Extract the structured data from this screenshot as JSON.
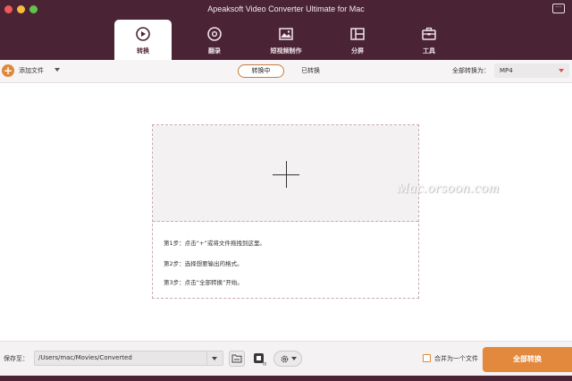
{
  "window": {
    "title": "Apeaksoft Video Converter Ultimate for Mac"
  },
  "tabs": [
    {
      "label": "转换",
      "icon": "convert-icon",
      "active": true
    },
    {
      "label": "翻录",
      "icon": "ripper-icon",
      "active": false
    },
    {
      "label": "短视频制作",
      "icon": "mv-maker-icon",
      "active": false
    },
    {
      "label": "分屏",
      "icon": "split-screen-icon",
      "active": false
    },
    {
      "label": "工具",
      "icon": "toolbox-icon",
      "active": false
    }
  ],
  "toolbar": {
    "add_file_label": "添加文件",
    "segment_converting": "转换中",
    "segment_converted": "已转换",
    "convert_all_to_label": "全部转换为：",
    "format_value": "MP4"
  },
  "drop_zone": {
    "steps": [
      "第1步：点击“+”或将文件拖拽到这里。",
      "第2步：选择想要输出的格式。",
      "第3步：点击“全部转换”开始。"
    ]
  },
  "watermark": "Mac.orsoon.com",
  "bottom": {
    "save_to_label": "保存至：",
    "save_path": "/Users/mac/Movies/Converted",
    "merge_label": "合并为一个文件",
    "convert_all_button": "全部转换"
  },
  "colors": {
    "header_bg": "#4a2335",
    "accent": "#e2893e",
    "tab_active_text": "#4a2335"
  }
}
